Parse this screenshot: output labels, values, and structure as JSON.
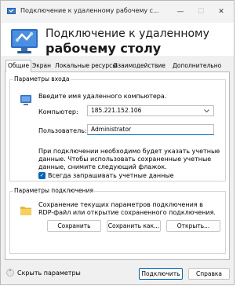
{
  "window": {
    "title": "Подключение к удаленному рабочему с...",
    "minimize_glyph": "—",
    "maximize_glyph": "☐",
    "close_glyph": "✕"
  },
  "banner": {
    "line1": "Подключение к удаленному",
    "line2": "рабочему столу"
  },
  "tabs": [
    {
      "label": "Общие",
      "active": true
    },
    {
      "label": "Экран"
    },
    {
      "label": "Локальные ресурсы"
    },
    {
      "label": "Взаимодействие"
    },
    {
      "label": "Дополнительно"
    }
  ],
  "login": {
    "group_title": "Параметры входа",
    "intro": "Введите имя удаленного компьютера.",
    "computer_label": "Компьютер:",
    "computer_value": "185.221.152.106",
    "user_label": "Пользователь:",
    "user_value": "Administrator",
    "note_lines": [
      "При подключении необходимо будет указать учетные",
      "данные. Чтобы использовать сохраненные учетные",
      "данные, снимите следующий флажок."
    ],
    "always_ask_label": "Всегда запрашивать учетные данные",
    "always_ask_checked": true
  },
  "connection": {
    "group_title": "Параметры подключения",
    "desc_lines": [
      "Сохранение текущих параметров подключения в",
      "RDP-файл или открытие сохраненного подключения."
    ],
    "save_label": "Сохранить",
    "save_as_label": "Сохранить как...",
    "open_label": "Открыть..."
  },
  "footer": {
    "hide_options_label": "Скрыть параметры",
    "connect_label": "Подключить",
    "help_label": "Справка"
  },
  "colors": {
    "accent": "#0067c0"
  }
}
